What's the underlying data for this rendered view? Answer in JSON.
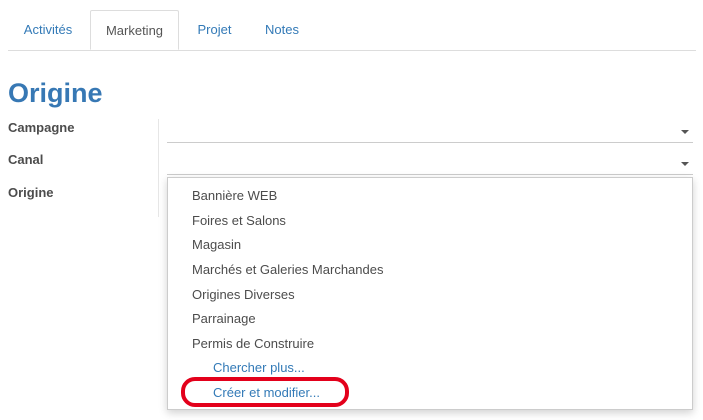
{
  "tabs": [
    {
      "label": "Activités",
      "active": false
    },
    {
      "label": "Marketing",
      "active": true
    },
    {
      "label": "Projet",
      "active": false
    },
    {
      "label": "Notes",
      "active": false
    }
  ],
  "section": {
    "title": "Origine"
  },
  "fields": {
    "campagne": {
      "label": "Campagne",
      "value": ""
    },
    "canal": {
      "label": "Canal",
      "value": ""
    },
    "origine": {
      "label": "Origine"
    }
  },
  "dropdown": {
    "options": [
      "Bannière WEB",
      "Foires et Salons",
      "Magasin",
      "Marchés et Galeries Marchandes",
      "Origines Diverses",
      "Parrainage",
      "Permis de Construire"
    ],
    "search_more": "Chercher plus...",
    "create_edit": "Créer et modifier..."
  },
  "colors": {
    "link": "#337ab7",
    "title": "#3778b4",
    "highlight": "#e3001b"
  },
  "icons": {
    "select_caret": "caret-down-icon"
  }
}
